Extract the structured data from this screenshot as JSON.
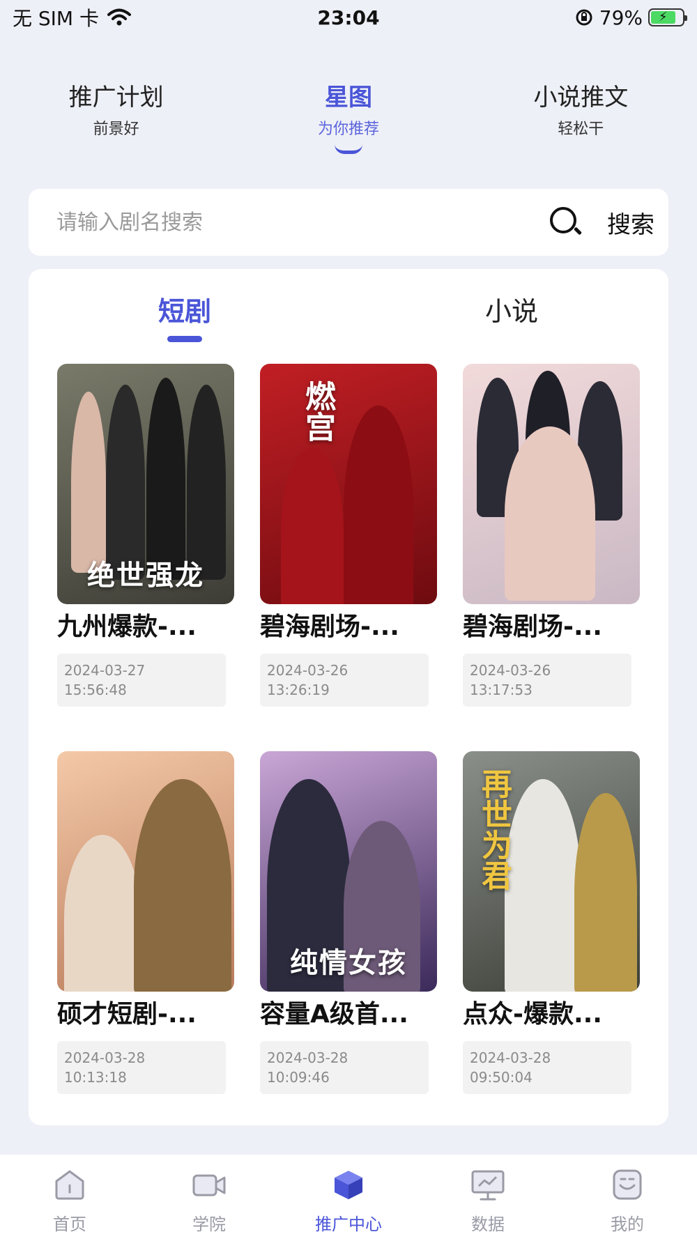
{
  "status_bar": {
    "carrier": "无 SIM 卡",
    "time": "23:04",
    "battery_percent": "79%",
    "battery_level": 0.79
  },
  "top_tabs": [
    {
      "title": "推广计划",
      "subtitle": "前景好",
      "active": false
    },
    {
      "title": "星图",
      "subtitle": "为你推荐",
      "active": true
    },
    {
      "title": "小说推文",
      "subtitle": "轻松干",
      "active": false
    }
  ],
  "search": {
    "placeholder": "请输入剧名搜索",
    "button_label": "搜索"
  },
  "sub_tabs": {
    "short_drama": "短剧",
    "novel": "小说"
  },
  "items": [
    {
      "title": "九州爆款-...",
      "date": "2024-03-27",
      "time": "15:56:48",
      "poster_text": "绝世强龙",
      "poster_colors": [
        "#7a7a6a",
        "#3d3d36"
      ]
    },
    {
      "title": "碧海剧场-...",
      "date": "2024-03-26",
      "time": "13:26:19",
      "poster_text": "燃宫",
      "poster_colors": [
        "#c11f24",
        "#6e0b10"
      ]
    },
    {
      "title": "碧海剧场-...",
      "date": "2024-03-26",
      "time": "13:17:53",
      "poster_text": "",
      "poster_colors": [
        "#f2dada",
        "#c9b8c4"
      ]
    },
    {
      "title": "硕才短剧-...",
      "date": "2024-03-28",
      "time": "10:13:18",
      "poster_text": "",
      "poster_colors": [
        "#f4c9a8",
        "#b77a5a"
      ]
    },
    {
      "title": "容量A级首...",
      "date": "2024-03-28",
      "time": "10:09:46",
      "poster_text": "纯情女孩",
      "poster_colors": [
        "#c9a6d6",
        "#3b2a5a"
      ]
    },
    {
      "title": "点众-爆款...",
      "date": "2024-03-28",
      "time": "09:50:04",
      "poster_text": "再世为君",
      "poster_colors": [
        "#8a8f8a",
        "#3d4038"
      ]
    }
  ],
  "bottom_nav": [
    {
      "label": "首页",
      "icon": "home-icon",
      "active": false
    },
    {
      "label": "学院",
      "icon": "video-camera-icon",
      "active": false
    },
    {
      "label": "推广中心",
      "icon": "cube-icon",
      "active": true
    },
    {
      "label": "数据",
      "icon": "chart-board-icon",
      "active": false
    },
    {
      "label": "我的",
      "icon": "smiley-face-icon",
      "active": false
    }
  ],
  "colors": {
    "accent": "#4a55d8",
    "background": "#eef0f7"
  }
}
